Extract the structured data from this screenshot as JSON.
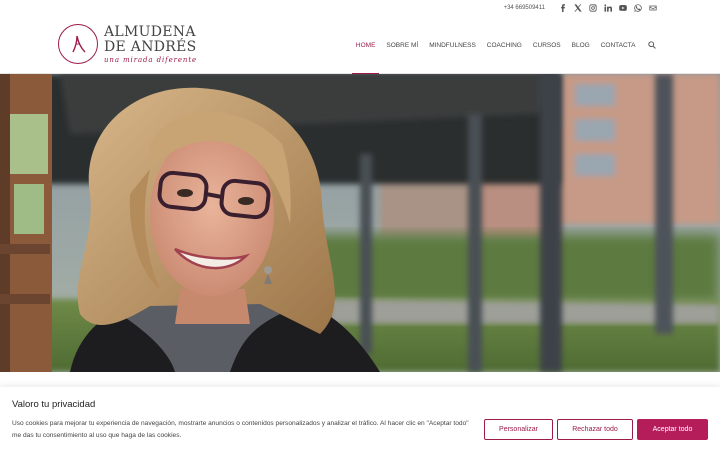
{
  "topbar": {
    "phone": "+34 669509411",
    "social": [
      {
        "icon": "facebook-icon"
      },
      {
        "icon": "x-twitter-icon"
      },
      {
        "icon": "instagram-icon"
      },
      {
        "icon": "linkedin-icon"
      },
      {
        "icon": "youtube-icon"
      },
      {
        "icon": "whatsapp-icon"
      },
      {
        "icon": "mail-icon"
      }
    ]
  },
  "logo": {
    "line1": "ALMUDENA",
    "line2": "DE ANDRÉS",
    "tagline": "una mirada diferente"
  },
  "nav": {
    "items": [
      {
        "label": "HOME",
        "active": true
      },
      {
        "label": "SOBRE MÍ"
      },
      {
        "label": "MINDFULNESS"
      },
      {
        "label": "COACHING"
      },
      {
        "label": "CURSOS"
      },
      {
        "label": "BLOG"
      },
      {
        "label": "CONTACTA"
      }
    ],
    "search_icon": "search-icon"
  },
  "colors": {
    "brand": "#9b1b4b",
    "accept_button": "#b51c5a"
  },
  "cookie": {
    "title": "Valoro tu privacidad",
    "text": "Uso cookies para mejorar tu experiencia de navegación, mostrarte anuncios o contenidos personalizados y analizar el tráfico. Al hacer clic en \"Aceptar todo\" me das tu consentimiento al uso que haga de las cookies.",
    "customize_label": "Personalizar",
    "reject_label": "Rechazar todo",
    "accept_label": "Aceptar todo"
  }
}
